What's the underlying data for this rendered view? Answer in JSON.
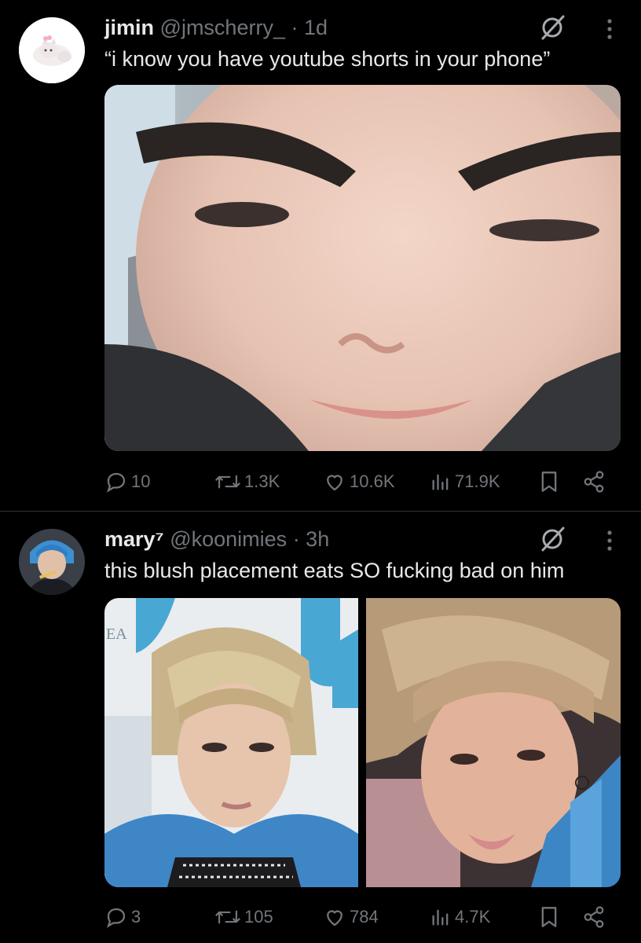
{
  "tweets": [
    {
      "name": "jimin",
      "handle": "@jmscherry_",
      "time": "· 1d",
      "text": "“i know you have youtube shorts in your phone”",
      "avatar_icon": "cat-avatar",
      "stats": {
        "replies": "10",
        "reposts": "1.3K",
        "likes": "10.6K",
        "views": "71.9K"
      }
    },
    {
      "name": "mary⁷",
      "handle": "@koonimies",
      "time": "· 3h",
      "text": "this blush placement eats SO fucking bad on him",
      "avatar_icon": "user-avatar",
      "magazine_text": "EA",
      "stats": {
        "replies": "3",
        "reposts": "105",
        "likes": "784",
        "views": "4.7K"
      }
    }
  ],
  "colors": {
    "background": "#000000",
    "text": "#e7e9ea",
    "muted": "#71767b",
    "divider": "#2f3336"
  }
}
